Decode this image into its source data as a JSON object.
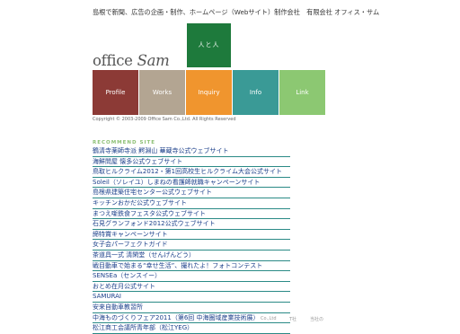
{
  "header": {
    "tagline": "島根で新聞、広告の企画・制作、ホームページ（Webサイト）制作会社　有限会社 オフィス・サム",
    "logo_text_office": "office",
    "logo_text_sam": "Sam",
    "green_block_label": "人と人"
  },
  "nav": {
    "items": [
      {
        "label": "Profile",
        "color": "#8c3a36"
      },
      {
        "label": "Works",
        "color": "#b3a592"
      },
      {
        "label": "Inquiry",
        "color": "#f0952e"
      },
      {
        "label": "Info",
        "color": "#3a9a96"
      },
      {
        "label": "Link",
        "color": "#8cc872"
      }
    ]
  },
  "copyright": "Copyright © 2003-2009 Office Sam Co.,Ltd. All Rights Reserved",
  "recommend": {
    "heading": "RECOMMEND SITE",
    "links": [
      "鶴清寺薬師寺派 鰐淵山 華蔵寺公式ウェブサイト",
      "海鮮問屋 懐多公式ウェブサイト",
      "鳥取ヒルクライム2012・第1回高校生ヒルクライム大会公式サイト",
      "Soleil（ソレイユ）しまねの看護師就職キャンペーンサイト",
      "島根県建築住宅センター公式ウェブサイト",
      "キッチンおかだ公式ウェブサイト",
      "まつえ噺鉄食フェスタ公式ウェブサイト",
      "石見グランフォンド2012公式ウェブサイト",
      "締特賞キャンペーンサイト",
      "女子会パーフェクトガイド",
      "茶道具一式 清閑堂（せんげんどう）",
      "戦目動車で始まる“幸せ生活”、撮れたよ！フォトコンテスト",
      "SENSEa（センスイー）",
      "おとめ在月公式サイト",
      "SAMURAI",
      "安来自動車教習所",
      "中海ものづくりフェア2011（第6回 中海圏域産業技術展）",
      "松江商工会議所青年部（松江YEG）"
    ]
  },
  "footer_fragments": [
    "Co.,Ltd",
    "T社",
    "当社の"
  ]
}
